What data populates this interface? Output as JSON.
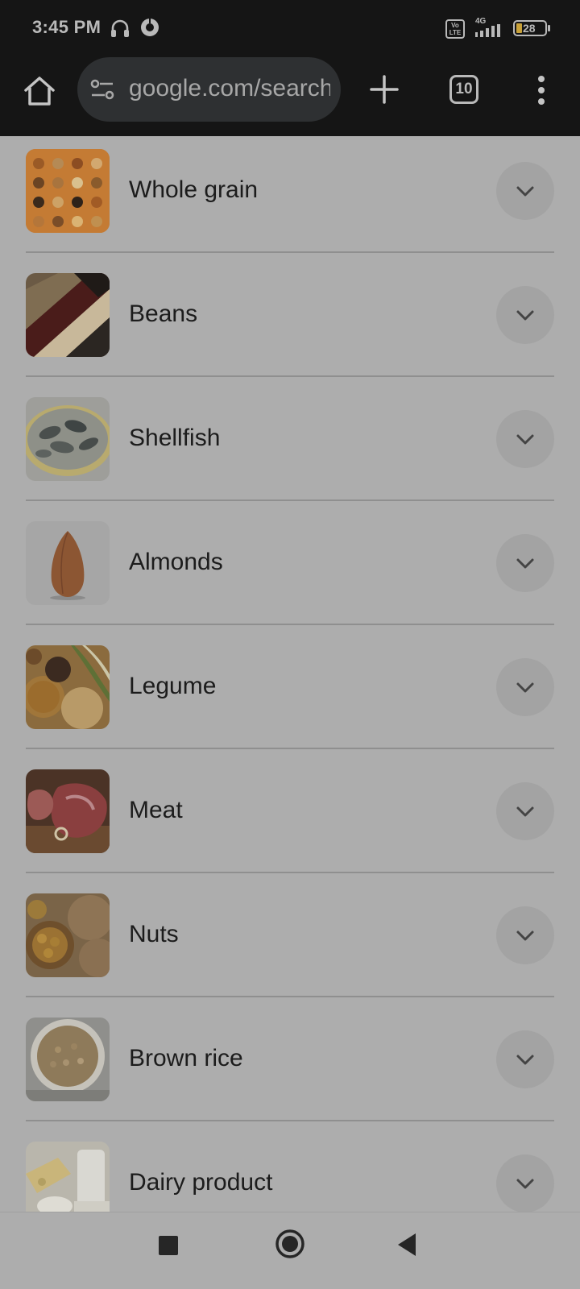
{
  "status_bar": {
    "time": "3:45 PM",
    "volte": "Vo LTE",
    "network": "4G",
    "battery": "28"
  },
  "toolbar": {
    "url": "google.com/search",
    "tab_count": "10"
  },
  "items": [
    {
      "label": "Whole grain"
    },
    {
      "label": "Beans"
    },
    {
      "label": "Shellfish"
    },
    {
      "label": "Almonds"
    },
    {
      "label": "Legume"
    },
    {
      "label": "Meat"
    },
    {
      "label": "Nuts"
    },
    {
      "label": "Brown rice"
    },
    {
      "label": "Dairy product"
    }
  ],
  "icons": {
    "home": "home-icon",
    "site_settings": "tune-icon",
    "new_tab": "plus-icon",
    "menu": "more-vert-icon",
    "expand": "chevron-down-icon"
  }
}
